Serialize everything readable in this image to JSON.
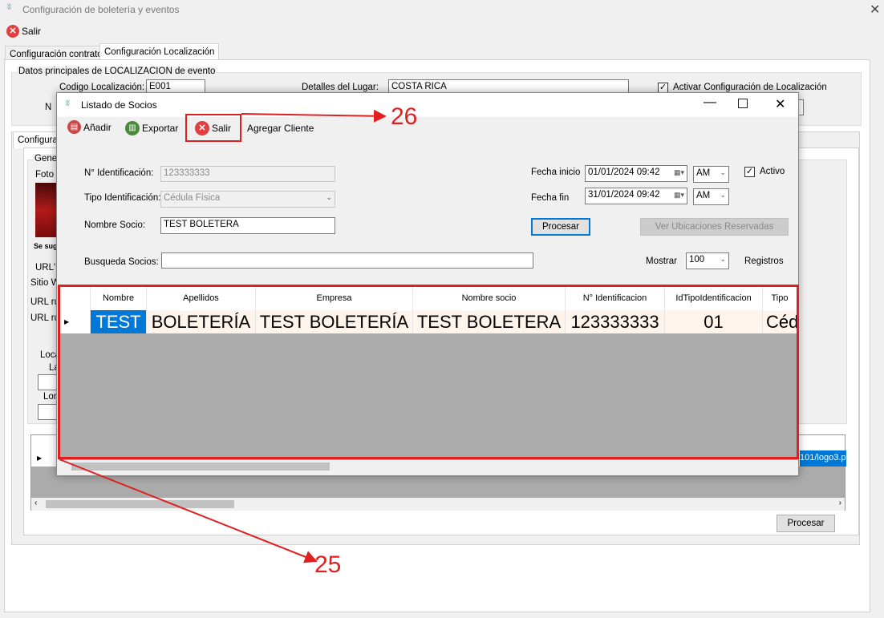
{
  "main_window": {
    "title": "Configuración de boletería y eventos",
    "exit_label": "Salir",
    "tabs": [
      "Configuración contrato",
      "Configuración Localización"
    ],
    "group_title": "Datos principales de LOCALIZACION de evento",
    "codigo_label": "Codigo Localización:",
    "codigo_value": "E001",
    "detalles_label": "Detalles del Lugar:",
    "detalles_value": "COSTA RICA",
    "activar_label": "Activar Configuración de Localización",
    "partial_n": "N",
    "partial_tab": "Configurac",
    "partial_general": "Genera",
    "partial_foto": "Foto d",
    "partial_se_sug": "Se sug",
    "partial_url": "URL's",
    "partial_sitio": "Sitio W",
    "partial_url_r1": "URL ru",
    "partial_url_r2": "URL ru",
    "partial_loca": "Loca",
    "partial_la": "La",
    "partial_lon": "Lon",
    "bg_grid_value": "101/logo3.p",
    "procesar_label": "Procesar"
  },
  "dialog": {
    "title": "Listado de Socios",
    "toolbar": {
      "add_label": "Añadir",
      "export_label": "Exportar",
      "exit_label": "Salir",
      "add_client_label": "Agregar Cliente"
    },
    "form": {
      "id_label": "N° Identificación:",
      "id_value": "123333333",
      "tipo_label": "Tipo Identificación:",
      "tipo_value": "Cédula Física",
      "nombre_label": "Nombre Socio:",
      "nombre_value": "TEST BOLETERA",
      "busqueda_label": "Busqueda Socios:",
      "busqueda_value": "",
      "fecha_inicio_label": "Fecha inicio",
      "fecha_inicio_value": "01/01/2024 09:42",
      "fecha_inicio_ampm": "AM",
      "fecha_fin_label": "Fecha fin",
      "fecha_fin_value": "31/01/2024 09:42",
      "fecha_fin_ampm": "AM",
      "activo_label": "Activo",
      "procesar_label": "Procesar",
      "ver_label": "Ver Ubicaciones Reservadas",
      "mostrar_label": "Mostrar",
      "mostrar_value": "100",
      "registros_label": "Registros"
    },
    "grid": {
      "columns": [
        "Nombre",
        "Apellidos",
        "Empresa",
        "Nombre socio",
        "N° Identificacion",
        "IdTipoIdentificacion",
        "Tipo"
      ],
      "row": [
        "TEST",
        "BOLETERÍA",
        "TEST BOLETERÍA",
        "TEST BOLETERA",
        "123333333",
        "01",
        "Céd"
      ]
    }
  },
  "annotations": {
    "label_26": "26",
    "label_25": "25",
    "color": "#e02020"
  }
}
